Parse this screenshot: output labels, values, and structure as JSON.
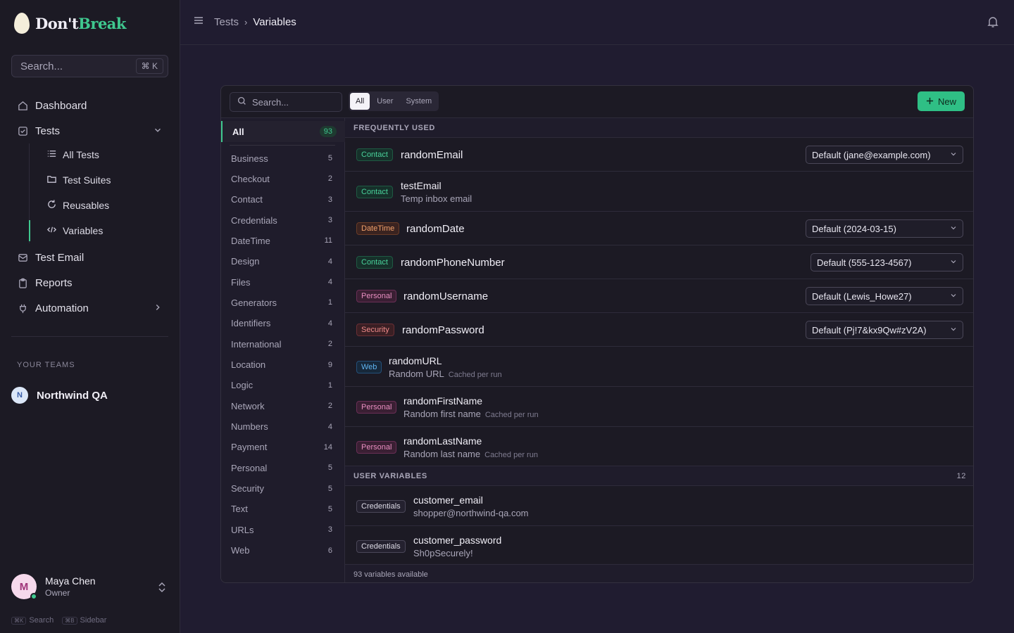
{
  "app": {
    "brand_a": "Don't",
    "brand_b": "Break"
  },
  "sidebar": {
    "search_placeholder": "Search...",
    "search_shortcut": "⌘ K",
    "nav": {
      "dashboard": "Dashboard",
      "tests": "Tests",
      "all_tests": "All Tests",
      "test_suites": "Test Suites",
      "reusables": "Reusables",
      "variables": "Variables",
      "test_email": "Test Email",
      "reports": "Reports",
      "automation": "Automation"
    },
    "teams_label": "YOUR TEAMS",
    "team": {
      "initial": "N",
      "name": "Northwind QA"
    },
    "user": {
      "initial": "M",
      "name": "Maya Chen",
      "role": "Owner"
    },
    "hints": [
      {
        "key": "⌘K",
        "label": "Search"
      },
      {
        "key": "⌘B",
        "label": "Sidebar"
      }
    ]
  },
  "header": {
    "crumb_parent": "Tests",
    "crumb_current": "Variables"
  },
  "panel": {
    "search_placeholder": "Search...",
    "segments": {
      "all": "All",
      "user": "User",
      "system": "System"
    },
    "new_label": "New",
    "categories_all": {
      "label": "All",
      "count": "93"
    },
    "categories": [
      {
        "label": "Business",
        "count": "5"
      },
      {
        "label": "Checkout",
        "count": "2"
      },
      {
        "label": "Contact",
        "count": "3"
      },
      {
        "label": "Credentials",
        "count": "3"
      },
      {
        "label": "DateTime",
        "count": "11"
      },
      {
        "label": "Design",
        "count": "4"
      },
      {
        "label": "Files",
        "count": "4"
      },
      {
        "label": "Generators",
        "count": "1"
      },
      {
        "label": "Identifiers",
        "count": "4"
      },
      {
        "label": "International",
        "count": "2"
      },
      {
        "label": "Location",
        "count": "9"
      },
      {
        "label": "Logic",
        "count": "1"
      },
      {
        "label": "Network",
        "count": "2"
      },
      {
        "label": "Numbers",
        "count": "4"
      },
      {
        "label": "Payment",
        "count": "14"
      },
      {
        "label": "Personal",
        "count": "5"
      },
      {
        "label": "Security",
        "count": "5"
      },
      {
        "label": "Text",
        "count": "5"
      },
      {
        "label": "URLs",
        "count": "3"
      },
      {
        "label": "Web",
        "count": "6"
      }
    ],
    "frequent_label": "FREQUENTLY USED",
    "user_vars_label": "USER VARIABLES",
    "user_vars_count": "12",
    "rows": {
      "r1": {
        "badge": "Contact",
        "name": "randomEmail",
        "select": "Default (jane@example.com)"
      },
      "r2": {
        "badge": "Contact",
        "name": "testEmail",
        "desc": "Temp inbox email"
      },
      "r3": {
        "badge": "DateTime",
        "name": "randomDate",
        "select": "Default (2024-03-15)"
      },
      "r4": {
        "badge": "Contact",
        "name": "randomPhoneNumber",
        "select": "Default (555-123-4567)"
      },
      "r5": {
        "badge": "Personal",
        "name": "randomUsername",
        "select": "Default (Lewis_Howe27)"
      },
      "r6": {
        "badge": "Security",
        "name": "randomPassword",
        "select": "Default (Pj!7&kx9Qw#zV2A)"
      },
      "r7": {
        "badge": "Web",
        "name": "randomURL",
        "desc": "Random URL",
        "note": "Cached per run"
      },
      "r8": {
        "badge": "Personal",
        "name": "randomFirstName",
        "desc": "Random first name",
        "note": "Cached per run"
      },
      "r9": {
        "badge": "Personal",
        "name": "randomLastName",
        "desc": "Random last name",
        "note": "Cached per run"
      },
      "u1": {
        "badge": "Credentials",
        "name": "customer_email",
        "desc": "shopper@northwind-qa.com"
      },
      "u2": {
        "badge": "Credentials",
        "name": "customer_password",
        "desc": "Sh0pSecurely!"
      }
    },
    "footer": "93 variables available"
  },
  "colors": {
    "accent": "#3fc88f",
    "background": "#201c30",
    "sidebar": "#1c1a24"
  }
}
